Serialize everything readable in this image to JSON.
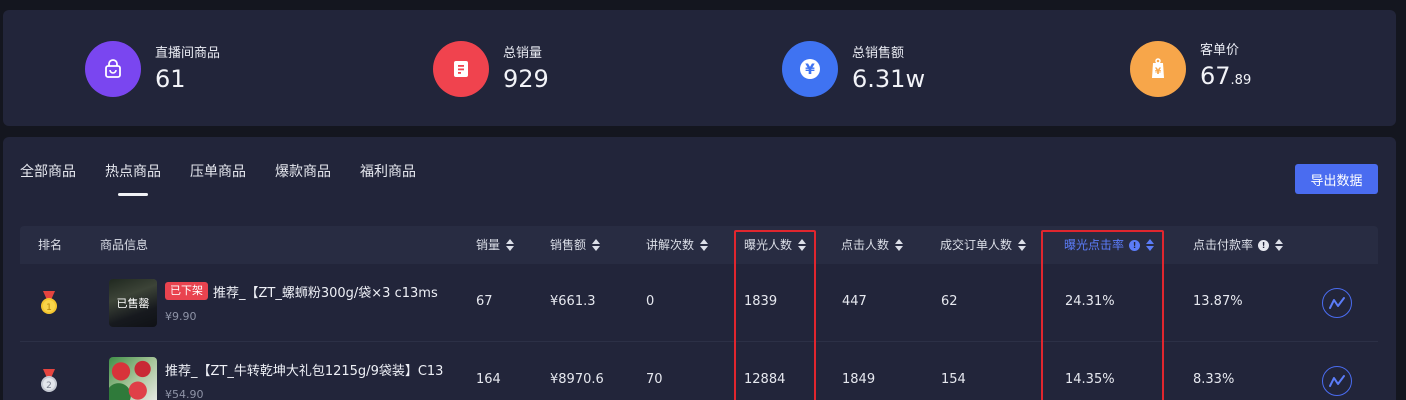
{
  "stats": [
    {
      "label": "直播间商品",
      "value": "61",
      "value_small": "",
      "color": "#7a46f0",
      "icon": "shopping-bag-icon"
    },
    {
      "label": "总销量",
      "value": "929",
      "value_small": "",
      "color": "#f0434e",
      "icon": "receipt-icon"
    },
    {
      "label": "总销售额",
      "value": "6.31w",
      "value_small": "",
      "color": "#3f73f2",
      "icon": "yuan-icon"
    },
    {
      "label": "客单价",
      "value": "67",
      "value_small": ".89",
      "color": "#f7a64a",
      "icon": "price-tag-icon"
    }
  ],
  "tabs": [
    {
      "label": "全部商品",
      "active": false
    },
    {
      "label": "热点商品",
      "active": true
    },
    {
      "label": "压单商品",
      "active": false
    },
    {
      "label": "爆款商品",
      "active": false
    },
    {
      "label": "福利商品",
      "active": false
    }
  ],
  "export_label": "导出数据",
  "columns": {
    "rank": "排名",
    "product": "商品信息",
    "sales": "销量",
    "revenue": "销售额",
    "explain_count": "讲解次数",
    "exposure": "曝光人数",
    "clicks": "点击人数",
    "orders": "成交订单人数",
    "exposure_ctr": "曝光点击率",
    "click_pay_rate": "点击付款率"
  },
  "rows": [
    {
      "rank": 1,
      "rank_icon": "gold-medal-icon",
      "sold_out": "已售罄",
      "off_shelf": "已下架",
      "name": "推荐_【ZT_螺蛳粉300g/袋×3 c13ms",
      "price": "¥9.90",
      "sales": "67",
      "revenue": "¥661.3",
      "explain_count": "0",
      "exposure": "1839",
      "clicks": "447",
      "orders": "62",
      "exposure_ctr": "24.31%",
      "click_pay_rate": "13.87%"
    },
    {
      "rank": 2,
      "rank_icon": "silver-medal-icon",
      "sold_out": "",
      "off_shelf": "",
      "name": "推荐_【ZT_牛转乾坤大礼包1215g/9袋装】C13",
      "price": "¥54.90",
      "sales": "164",
      "revenue": "¥8970.6",
      "explain_count": "70",
      "exposure": "12884",
      "clicks": "1849",
      "orders": "154",
      "exposure_ctr": "14.35%",
      "click_pay_rate": "8.33%"
    }
  ],
  "colors": {
    "accent": "#4a6cf0",
    "highlight_border": "#e0262e",
    "background": "#14161f",
    "panel": "#22253a"
  }
}
